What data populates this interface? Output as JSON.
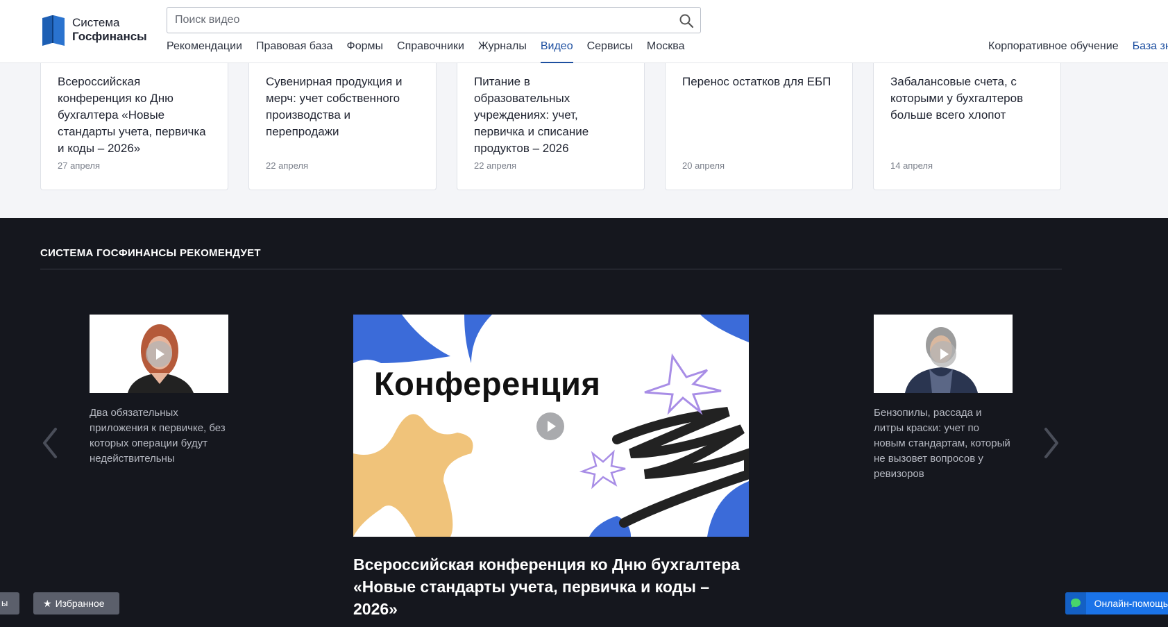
{
  "header": {
    "logo": {
      "line1": "Система",
      "line2": "Госфинансы"
    },
    "search": {
      "placeholder": "Поиск видео"
    },
    "nav": [
      {
        "label": "Рекомендации"
      },
      {
        "label": "Правовая база"
      },
      {
        "label": "Формы"
      },
      {
        "label": "Справочники"
      },
      {
        "label": "Журналы"
      },
      {
        "label": "Видео",
        "active": true
      },
      {
        "label": "Сервисы"
      },
      {
        "label": "Москва"
      }
    ],
    "nav_right": [
      {
        "label": "Корпоративное обучение"
      },
      {
        "label": "База знаний"
      }
    ]
  },
  "cards": [
    {
      "title": "Всероссийская конференция ко Дню бухгалтера «Новые стандарты учета, первичка и коды – 2026»",
      "date": "27 апреля"
    },
    {
      "title": "Сувенирная продукция и мерч: учет собственного производства и перепродажи",
      "date": "22 апреля"
    },
    {
      "title": "Питание в образовательных учреждениях: учет, первичка и списание продуктов – 2026",
      "date": "22 апреля"
    },
    {
      "title": "Перенос остатков для ЕБП",
      "date": "20 апреля"
    },
    {
      "title": "Забалансовые счета, с которыми у бухгалтеров больше всего хлопот",
      "date": "14 апреля"
    }
  ],
  "recommend": {
    "heading": "СИСТЕМА ГОСФИНАНСЫ РЕКОМЕНДУЕТ",
    "left": {
      "text": "Два обязательных приложения к первичке, без которых операции будут недействительны"
    },
    "main": {
      "overlay": "Конференция",
      "title": "Всероссийская конференция ко Дню бухгалтера «Новые стандарты учета, первичка и коды – 2026»"
    },
    "right": {
      "text": "Бензопилы, рассада и литры краски: учет по новым стандартам, который не вызовет вопросов у ревизоров"
    }
  },
  "floating": {
    "left_partial": "ы",
    "favorites": "Избранное",
    "help": "Онлайн-помощь"
  },
  "colors": {
    "accent": "#1d4fa0",
    "dark_bg": "#15171e",
    "help_blue": "#1a73e8"
  }
}
